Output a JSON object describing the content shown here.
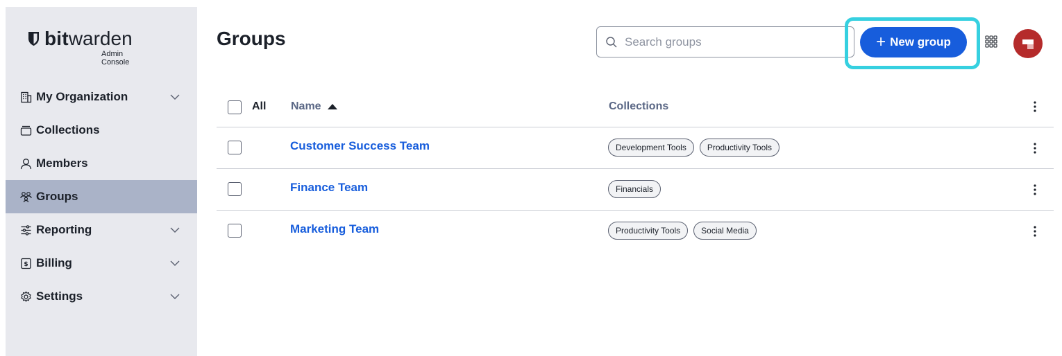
{
  "brand": {
    "name_bold": "bit",
    "name_regular": "warden",
    "subtitle": "Admin Console"
  },
  "sidebar": {
    "items": [
      {
        "label": "My Organization",
        "icon": "organization-icon",
        "expandable": true,
        "active": false
      },
      {
        "label": "Collections",
        "icon": "collections-icon",
        "expandable": false,
        "active": false
      },
      {
        "label": "Members",
        "icon": "user-icon",
        "expandable": false,
        "active": false
      },
      {
        "label": "Groups",
        "icon": "groups-icon",
        "expandable": false,
        "active": true
      },
      {
        "label": "Reporting",
        "icon": "sliders-icon",
        "expandable": true,
        "active": false
      },
      {
        "label": "Billing",
        "icon": "billing-icon",
        "expandable": true,
        "active": false
      },
      {
        "label": "Settings",
        "icon": "gear-icon",
        "expandable": true,
        "active": false
      }
    ]
  },
  "header": {
    "title": "Groups",
    "search_placeholder": "Search groups",
    "new_button_label": "New group",
    "new_button_plus": "+"
  },
  "table": {
    "select_all_label": "All",
    "columns": {
      "name": "Name",
      "collections": "Collections"
    },
    "rows": [
      {
        "name": "Customer Success Team",
        "collections": [
          "Development Tools",
          "Productivity Tools"
        ]
      },
      {
        "name": "Finance Team",
        "collections": [
          "Financials"
        ]
      },
      {
        "name": "Marketing Team",
        "collections": [
          "Productivity Tools",
          "Social Media"
        ]
      }
    ]
  },
  "colors": {
    "accent": "#175ddc",
    "highlight": "#36d0e0",
    "sidebar_bg": "#e8e9ee",
    "sidebar_active": "#aab3c8",
    "avatar": "#b52b2b"
  }
}
